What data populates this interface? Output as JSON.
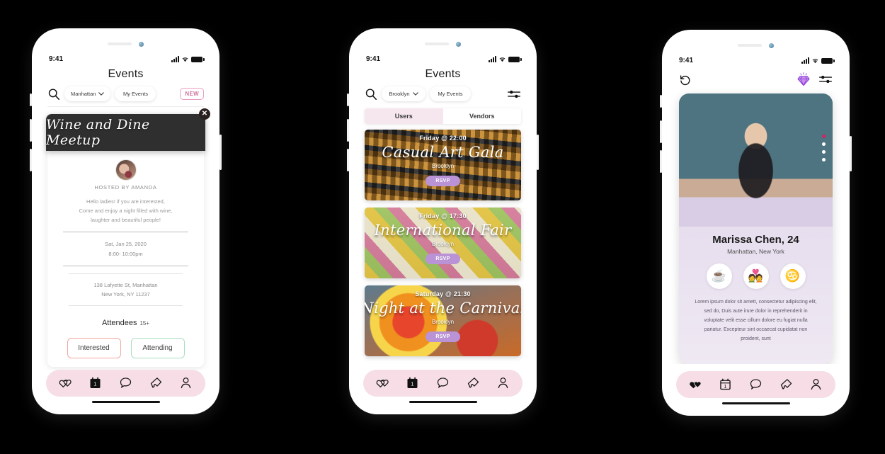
{
  "meta": {
    "background_color": "#000000",
    "frame_color": "#ffffff"
  },
  "status_bar": {
    "time": "9:41"
  },
  "phone1": {
    "title": "Events",
    "toolbar": {
      "search_icon": "search-icon",
      "location": "Manhattan",
      "my_events": "My Events",
      "new_badge": "NEW"
    },
    "card": {
      "banner_title": "Wine and Dine Meetup",
      "close_icon": "close-icon",
      "hosted_by": "HOSTED BY AMANDA",
      "blurb_line1": "Hello ladies! if you are interested,",
      "blurb_line2": "Come and enjoy a night filled with wine,",
      "blurb_line3": "laughter  and beautiful people!",
      "date": "Sat, Jan 25, 2020",
      "time": "8:00- 10:00pm",
      "address_line1": "138 Lafyette St, Manhattan",
      "address_line2": "New York, NY 11237",
      "attendees_label": "Attendees",
      "attendees_count": "15+",
      "interested_label": "Interested",
      "attending_label": "Attending"
    },
    "nav_active": "calendar"
  },
  "phone2": {
    "title": "Events",
    "toolbar": {
      "location": "Brooklyn",
      "my_events": "My Events",
      "filter_icon": "filter-sliders-icon"
    },
    "segments": [
      {
        "label": "Users",
        "active": true
      },
      {
        "label": "Vendors",
        "active": false
      }
    ],
    "events": [
      {
        "when": "Friday @ 22:00",
        "name": "Casual Art Gala",
        "city": "Brooklyn",
        "rsvp": "RSVP"
      },
      {
        "when": "Friday @ 17:30",
        "name": "International Fair",
        "city": "Brooklyn",
        "rsvp": "RSVP"
      },
      {
        "when": "Saturday @ 21:30",
        "name": "Night at the Carnival",
        "city": "Brooklyn",
        "rsvp": "RSVP"
      }
    ],
    "nav_active": "calendar"
  },
  "phone3": {
    "toolbar": {
      "undo_icon": "undo-rewind-icon",
      "gem_icon": "diamond-gem-icon",
      "filter_icon": "filter-sliders-icon"
    },
    "profile": {
      "name": "Marissa Chen, 24",
      "location": "Manhattan, New York",
      "photo_dots": 4,
      "photo_active_dot": 1,
      "interests": [
        {
          "icon": "coffee-cup-icon",
          "glyph": "☕"
        },
        {
          "icon": "couple-icon",
          "glyph": "💑"
        },
        {
          "icon": "cancer-zodiac-icon",
          "glyph": "♋"
        }
      ],
      "bio": "Lorem ipsum dolor sit amett, consectetur adipiscing elit, sed do, Duis aute irure dolor in reprehenderit in voluptate velit esse cillum dolore eu fugiat nulla pariatur. Excepteur sint occaecat cupidatat non proident, sunt"
    },
    "nav_active": "hearts"
  },
  "nav_items": [
    {
      "name": "hearts",
      "icon": "hearts-icon"
    },
    {
      "name": "calendar",
      "icon": "calendar-icon",
      "day": "1"
    },
    {
      "name": "chat",
      "icon": "chat-bubble-icon"
    },
    {
      "name": "tickets",
      "icon": "ticket-icon"
    },
    {
      "name": "profile",
      "icon": "person-icon"
    }
  ],
  "colors": {
    "nav_bg": "#f6dde6",
    "accent_pink": "#d3719e",
    "rsvp_purple": "#b993d6",
    "active_dot": "#d6206a",
    "interested_border": "#f2a7a0",
    "attending_border": "#a9dfbd"
  }
}
